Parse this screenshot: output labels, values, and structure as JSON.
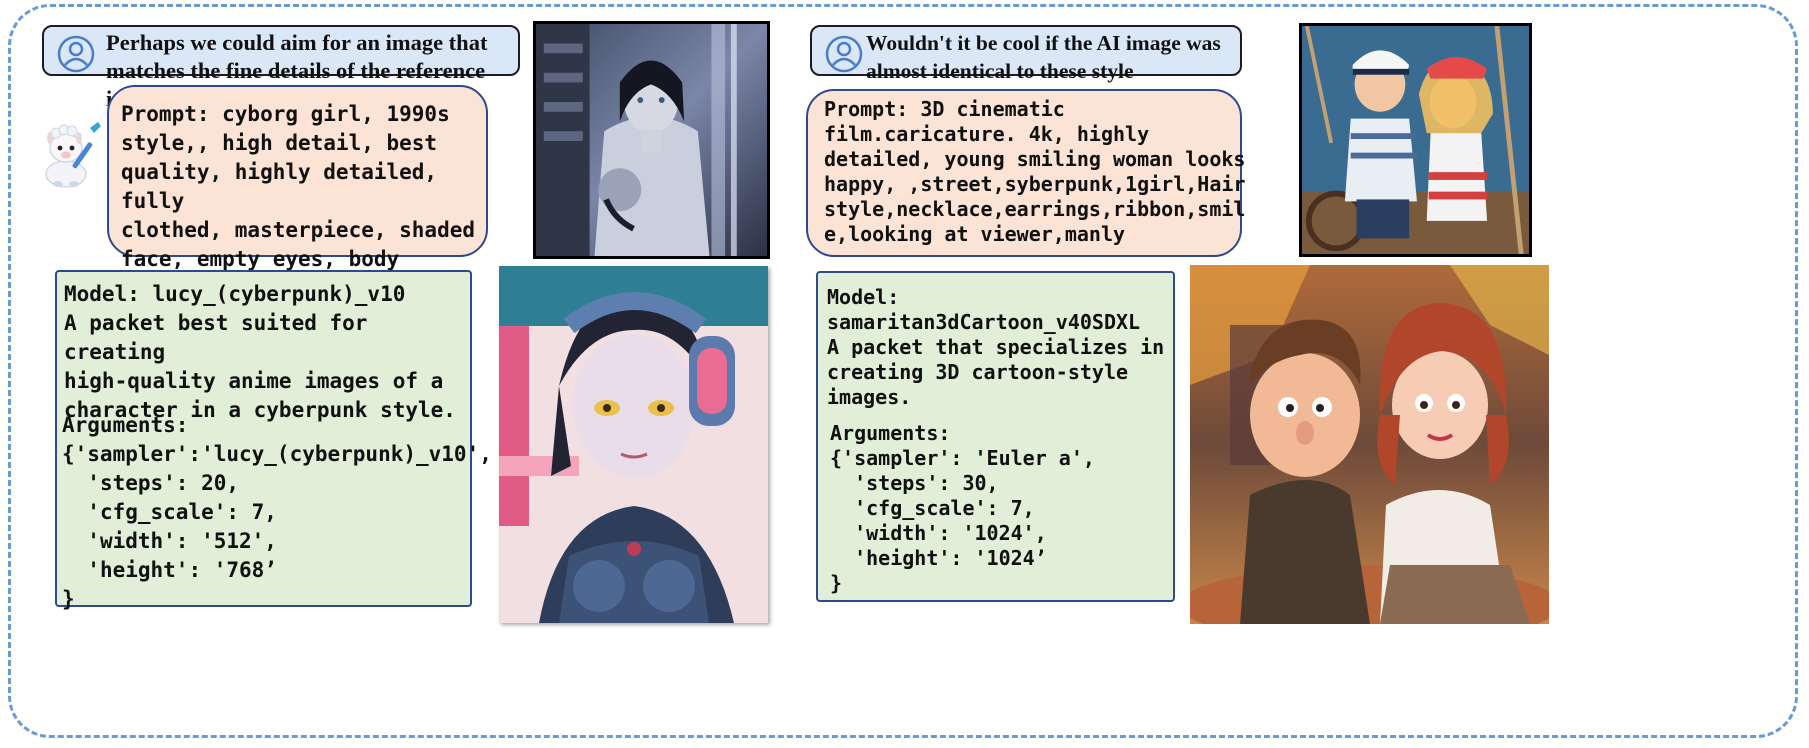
{
  "left_panel": {
    "user_question": "Perhaps we could aim for an image that\nmatches the fine details of the reference image?",
    "prompt_text": "Prompt: cyborg girl, 1990s\nstyle,, high detail, best\nquality, highly detailed, fully\nclothed, masterpiece, shaded\nface, empty eyes, body focus,\nmechanical parts, space station",
    "model_description": "Model: lucy_(cyberpunk)_v10\nA packet best suited for creating\nhigh-quality anime images of a\ncharacter in a cyberpunk style.",
    "arguments_text": "Arguments:\n{'sampler':'lucy_(cyberpunk)_v10',\n  'steps': 20,\n  'cfg_scale': 7,\n  'width': '512',\n  'height': '768’\n}"
  },
  "right_panel": {
    "user_question": "Wouldn't it be cool if the AI image was\nalmost identical to these style references?",
    "prompt_text": "Prompt: 3D cinematic\nfilm.caricature. 4k, highly\ndetailed, young smiling woman looks\nhappy, ,street,syberpunk,1girl,Hair\nstyle,necklace,earrings,ribbon,smil\ne,looking at viewer,manly",
    "model_description": "Model:\nsamaritan3dCartoon_v40SDXL\nA packet that specializes in\ncreating 3D cartoon-style\nimages.",
    "arguments_text": "Arguments:\n{'sampler': 'Euler a',\n  'steps': 30,\n  'cfg_scale': 7,\n  'width': '1024',\n  'height': '1024’\n}"
  },
  "icons": {
    "user": "user-avatar-icon",
    "assistant": "llama-painter-icon"
  },
  "colors": {
    "frame_dash": "#6a9ad6",
    "user_bubble": "#dae7f6",
    "prompt_bubble": "#fbe3d6",
    "model_box": "#e1efd9",
    "box_border": "#2e4a8e"
  }
}
